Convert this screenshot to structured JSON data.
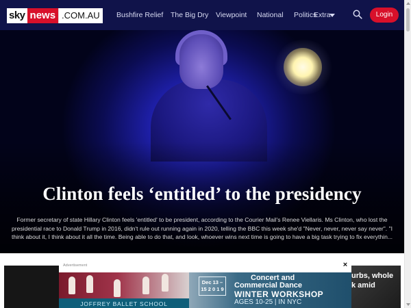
{
  "header": {
    "logo": {
      "part1": "sky",
      "part2": "news",
      "part3": ".COM.AU"
    },
    "nav": [
      "Bushfire Relief",
      "The Big Dry",
      "Viewpoint",
      "National",
      "Politics",
      "Extra"
    ],
    "login_label": "Login",
    "search_icon": "search-icon"
  },
  "colors": {
    "brand_navy": "#10134a",
    "brand_red": "#d8102a"
  },
  "hero": {
    "title": "Clinton feels ‘entitled’ to the presidency",
    "summary": "Former secretary of state Hillary Clinton feels 'entitled' to be president, according to the Courier Mail's Renee Viellaris. Ms Clinton, who lost the presidential race to Donald Trump in 2016, didn't rule out running again in 2020, telling the BBC this week she'd \"Never, never, never say never\". \"I think about it, I think about it all the time. Being able to do that, and look, whoever wins next time is going to have a big task trying to fix everythin..."
  },
  "ad": {
    "label": "Advertisement",
    "close": "×",
    "brand": "JOFFREY BALLET SCHOOL",
    "dates": "Dec 13 –15 2 0 1 9",
    "line1": "Concert and",
    "line2": "Commercial Dance",
    "line3": "WINTER WORKSHOP",
    "line4": "AGES 10-25 | IN NYC"
  },
  "side_story_text": "urbs, whole\nk amid"
}
